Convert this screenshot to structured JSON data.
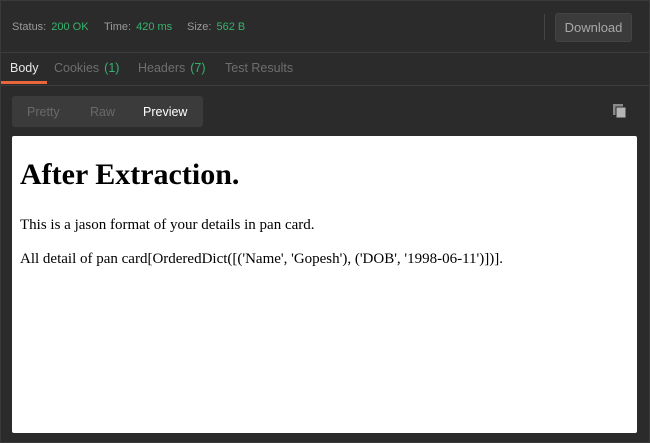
{
  "status_bar": {
    "status_label": "Status:",
    "status_value": "200 OK",
    "time_label": "Time:",
    "time_value": "420 ms",
    "size_label": "Size:",
    "size_value": "562 B",
    "download_label": "Download"
  },
  "tabs": [
    {
      "label": "Body",
      "count": ""
    },
    {
      "label": "Cookies",
      "count": "(1)"
    },
    {
      "label": "Headers",
      "count": "(7)"
    },
    {
      "label": "Test Results",
      "count": ""
    }
  ],
  "view_modes": [
    "Pretty",
    "Raw",
    "Preview"
  ],
  "active_view": "Preview",
  "preview": {
    "heading": "After Extraction.",
    "line1": "This is a jason format of your details in pan card.",
    "line2": "All detail of pan card[OrderedDict([('Name', 'Gopesh'), ('DOB', '1998-06-11')])]."
  },
  "colors": {
    "success": "#36b36b",
    "accent": "#e8663b",
    "background": "#2b2b2b"
  },
  "icons": {
    "copy": "copy-icon"
  }
}
